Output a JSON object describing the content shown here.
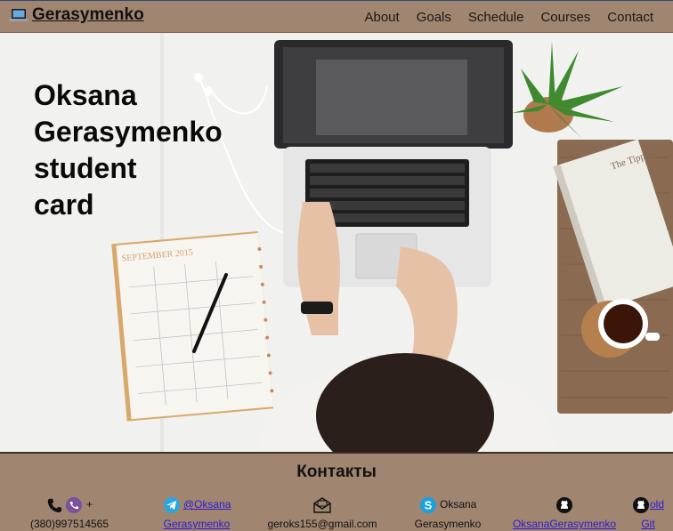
{
  "nav": {
    "brand": "Gerasymenko",
    "links": [
      "About",
      "Goals",
      "Schedule",
      "Courses",
      "Contact"
    ]
  },
  "hero": {
    "title_lines": [
      "Oksana",
      "Gerasymenko",
      "student",
      "card"
    ],
    "notebook_label": "SEPTEMBER 2015",
    "book_title": "The Tipping Point"
  },
  "footer": {
    "title": "Контакты",
    "phone": {
      "prefix": "+",
      "number": "(380)997514565"
    },
    "telegram": {
      "line1": "@Oksana",
      "line2": "Gerasymenko"
    },
    "email": "geroks155@gmail.com",
    "skype": {
      "line1": "Oksana",
      "line2": "Gerasymenko"
    },
    "github": "OksanaGerasymenko",
    "old_git": {
      "line1": "old",
      "line2": "Git"
    }
  },
  "colors": {
    "nav_bg": "#a08570",
    "link": "#2a1bd6"
  },
  "icons": [
    "laptop-icon",
    "phone-icon",
    "viber-icon",
    "telegram-icon",
    "mail-icon",
    "skype-icon",
    "github-icon"
  ]
}
